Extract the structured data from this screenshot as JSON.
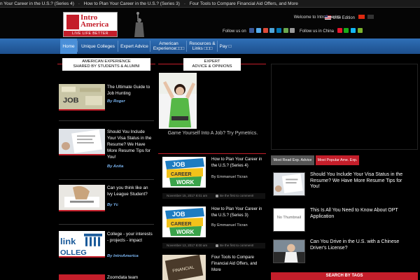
{
  "ticker": {
    "items": [
      "n Your Career in the U.S.? (Series 4)",
      "How to Plan Your Career in the U.S.? (Series 3)",
      "Four Tools to Compare Financial Aid Offers, and More"
    ],
    "sep": "-"
  },
  "header": {
    "logo_word1": "Intro",
    "logo_word2": "America",
    "logo_tagline": "LIVE LIFE BETTER",
    "welcome": "Welcome to IntroAmerica",
    "edition": "U.S. Edition",
    "follow_us": "Follow us on",
    "follow_china": "Follow us in China"
  },
  "nav": {
    "items": [
      {
        "label": "Home"
      },
      {
        "label": "Unique Colleges"
      },
      {
        "label": "Expert Advice"
      },
      {
        "label": "American Experience□□□"
      },
      {
        "label": "Resources & Links □□□"
      },
      {
        "label": "Pay □"
      }
    ]
  },
  "sections": {
    "left_heading_line1": "AMERICAN EXPERIENCE",
    "left_heading_line2": "SHARED BY STUDENTS & ALUMNI",
    "center_heading_line1": "EXPERT",
    "center_heading_line2": "ADVICE & OPINIONS"
  },
  "left_posts": [
    {
      "title": "The Ultimate Guide to Job Hunting",
      "by": "By Roger"
    },
    {
      "title": "Should You Include Your Visa Status in the Resume? We Have More Resume Tips for You!",
      "by": "By Anita"
    },
    {
      "title": "Can you think like an Ivy League Student?",
      "by": "By Yc"
    },
    {
      "title": "College - your interests - projects - impact",
      "by": "By IntroAmerica"
    },
    {
      "title": "Zoomdata team",
      "by": ""
    }
  ],
  "featured": {
    "caption": "Game Yourself Into A Job? Try Pymetrics."
  },
  "center_posts": [
    {
      "title": "How to Plan Your Career in the U.S.? (Series 4)",
      "by": "By Emmanuel Ticran",
      "date": "November 15, 2017 8:01 am",
      "comment": "Be the first to comment!"
    },
    {
      "title": "How to Plan Your Career in the U.S.? (Series 3)",
      "by": "By Emmanuel Ticran",
      "date": "November 13, 2017 8:00 am",
      "comment": "Be the first to comment!"
    },
    {
      "title": "Four Tools to Compare Financial Aid Offers, and More",
      "by": "",
      "date": "",
      "comment": ""
    }
  ],
  "right": {
    "tab_recent": "Most Read Exp. Advice",
    "tab_popular": "Most Popular Ame. Exp.",
    "items": [
      {
        "title": "Should You Include Your Visa Status in the Resume? We Have More Resume Tips for You!"
      },
      {
        "title": "This Is All You Need to Know About OPT Application",
        "thumb_text": "No Thumbnail"
      },
      {
        "title": "Can You Drive in the U.S. with a Chinese Driver's License?"
      }
    ],
    "tags_heading": "SEARCH BY TAGS"
  },
  "colors": {
    "accent_red": "#c41e2a",
    "nav_blue": "#2f6fb7",
    "link_blue": "#7ab4f0"
  }
}
